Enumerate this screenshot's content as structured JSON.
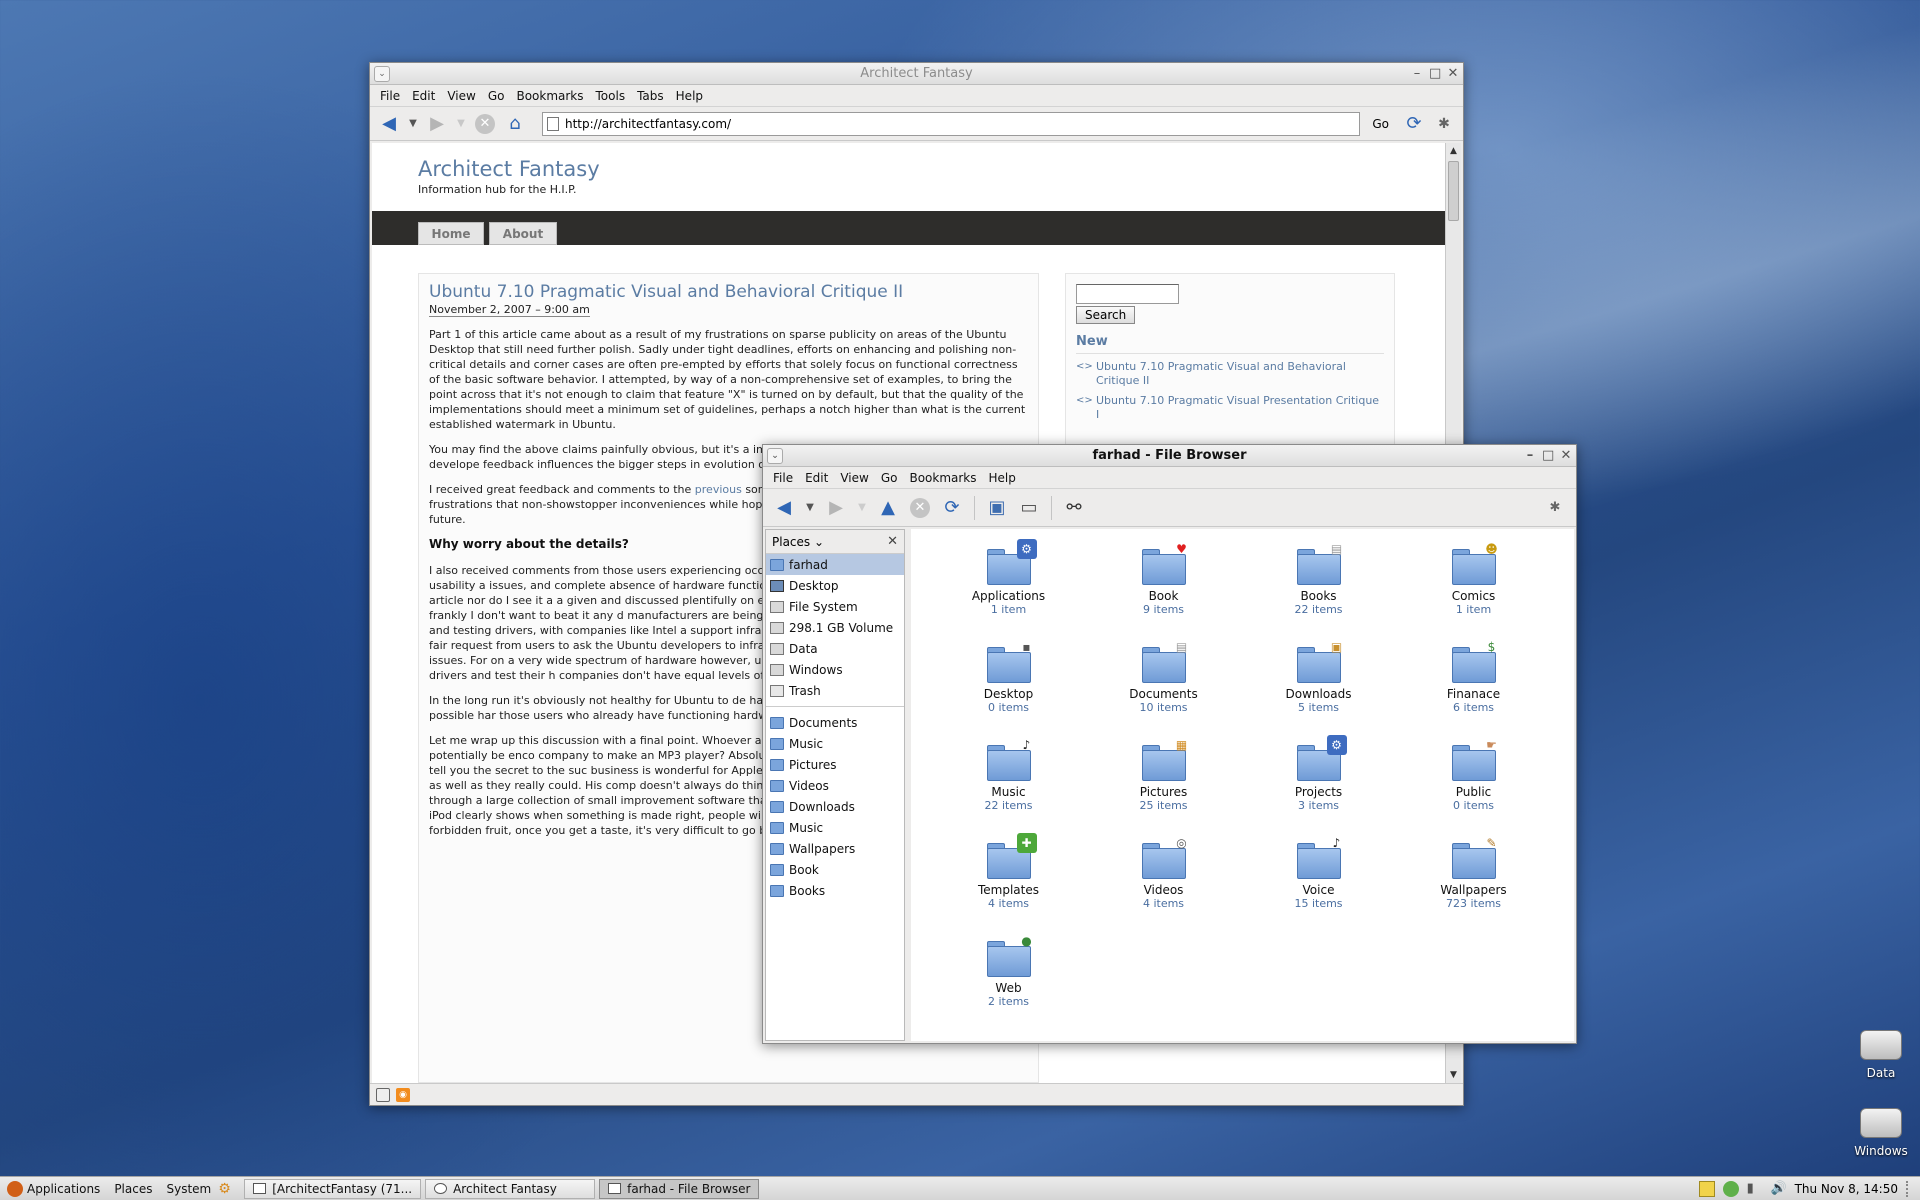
{
  "colors": {
    "link": "#5b7ca3",
    "folder": "#7ba5dc",
    "selection": "#b6c8e2",
    "nav_dark": "#2e2d2b"
  },
  "browser": {
    "window_title": "Architect Fantasy",
    "menu": [
      "File",
      "Edit",
      "View",
      "Go",
      "Bookmarks",
      "Tools",
      "Tabs",
      "Help"
    ],
    "url": "http://architectfantasy.com/",
    "go_label": "Go",
    "site": {
      "title": "Architect Fantasy",
      "subtitle": "Information hub for the H.I.P.",
      "nav": [
        "Home",
        "About"
      ]
    },
    "post": {
      "title": "Ubuntu 7.10 Pragmatic Visual and Behavioral Critique II",
      "date": "November 2, 2007 – 9:00 am",
      "p1": "Part 1 of this article came about as a result of my frustrations on sparse publicity on areas of the Ubuntu Desktop that still need further polish. Sadly under tight deadlines, efforts on enhancing and polishing non-critical details and corner cases are often pre-empted by efforts that solely focus on functional correctness of the basic software behavior. I attempted, by way of a non-comprehensive set of examples, to bring the point across that it's not enough to claim that feature \"X\" is turned on by default, but that the quality of the implementations should meet a minimum set of guidelines, perhaps a notch higher than what is the current established watermark in Ubuntu.",
      "p2": "You may find the above claims painfully obvious, but it's a impressions of the entire software experience to develope feedback influences the bigger steps in evolution of softw voiced as bug reports.",
      "p3a": "I received great feedback and comments to the ",
      "p3link": "previous",
      "p3b": " some users do indeed notice much of the frustrations that non-showstopper inconveniences while hoping their frustr pathway of the software in the future.",
      "h_why": "Why worry about the details?",
      "p4": "I also received comments from those users experiencing occasional graphical glitches and artifacts, and usability a issues, and complete absence of hardware functionality, a not belittling these issues with this article nor do I see it a a given and discussed plentifully on every other Linux rela very dead horse, and frankly I don't want to beat it any d manufacturers are being pressured into disclosing hardwa developing and testing drivers, with companies like Intel a support infrastructure (Note: not the hardware issues ther a fair request from users to ask the Ubuntu developers to infrastructure to identify and report hardware issues. For on a very wide spectrum of hardware however, unlike Ma where manufacturers fail to supply drivers and test their h companies don't have equal levels of commitment to thei development.",
      "p5": "In the long run it's obviously not healthy for Ubuntu to de hardware compatibility in order to validate all possible har those users who already have functioning hardware?",
      "p6": "Let me wrap up this discussion with a final point. Whoever a big deal out of the little quirks, could potentially be enco company to make an MP3 player? Absolutely not. Then wl media? If Steve Jobs were to tell you the secret to the suc business is wonderful for Apple because so many people n them poorly, or not as well as they really could. His comp doesn't always do things differently by creating a fundame succeeds through a large collection of small improvement software that provides a new and revolutionary experience. iPod clearly shows when something is made right, people will notice the pleasant experience, and like the forbidden fruit, once you get a taste, it's very difficult to go back to your ignorant ways."
    },
    "sidebar": {
      "search_label": "Search",
      "new_heading": "New",
      "links": [
        "Ubuntu 7.10 Pragmatic Visual and Behavioral Critique II",
        "Ubuntu 7.10 Pragmatic Visual Presentation Critique I"
      ]
    }
  },
  "filebrowser": {
    "window_title": "farhad - File Browser",
    "menu": [
      "File",
      "Edit",
      "View",
      "Go",
      "Bookmarks",
      "Help"
    ],
    "places_label": "Places",
    "places": [
      "farhad",
      "Desktop",
      "File System",
      "298.1 GB Volume",
      "Data",
      "Windows",
      "Trash"
    ],
    "bookmarks": [
      "Documents",
      "Music",
      "Pictures",
      "Videos",
      "Downloads",
      "Music",
      "Wallpapers",
      "Book",
      "Books"
    ],
    "items": [
      {
        "name": "Applications",
        "count": "1 item",
        "emblem": "gear-emblem"
      },
      {
        "name": "Book",
        "count": "9 items",
        "emblem": "heart-emblem"
      },
      {
        "name": "Books",
        "count": "22 items",
        "emblem": "document-emblem"
      },
      {
        "name": "Comics",
        "count": "1 item",
        "emblem": "smiley-emblem"
      },
      {
        "name": "Desktop",
        "count": "0 items",
        "emblem": "desktop-emblem"
      },
      {
        "name": "Documents",
        "count": "10 items",
        "emblem": "document-emblem"
      },
      {
        "name": "Downloads",
        "count": "5 items",
        "emblem": "package-emblem"
      },
      {
        "name": "Finanace",
        "count": "6 items",
        "emblem": "money-emblem"
      },
      {
        "name": "Music",
        "count": "22 items",
        "emblem": "speaker-emblem"
      },
      {
        "name": "Pictures",
        "count": "25 items",
        "emblem": "photo-emblem"
      },
      {
        "name": "Projects",
        "count": "3 items",
        "emblem": "gear-emblem"
      },
      {
        "name": "Public",
        "count": "0 items",
        "emblem": "share-emblem"
      },
      {
        "name": "Templates",
        "count": "4 items",
        "emblem": "plus-emblem"
      },
      {
        "name": "Videos",
        "count": "4 items",
        "emblem": "camera-emblem"
      },
      {
        "name": "Voice",
        "count": "15 items",
        "emblem": "speaker-emblem"
      },
      {
        "name": "Wallpapers",
        "count": "723 items",
        "emblem": "brush-emblem"
      },
      {
        "name": "Web",
        "count": "2 items",
        "emblem": "globe-emblem"
      }
    ]
  },
  "desktop": {
    "icons": [
      "Data",
      "Windows"
    ]
  },
  "panel": {
    "menus": [
      "Applications",
      "Places",
      "System"
    ],
    "tasks": [
      "[ArchitectFantasy (71...",
      "Architect Fantasy",
      "farhad - File Browser"
    ],
    "clock": "Thu Nov  8, 14:50"
  }
}
